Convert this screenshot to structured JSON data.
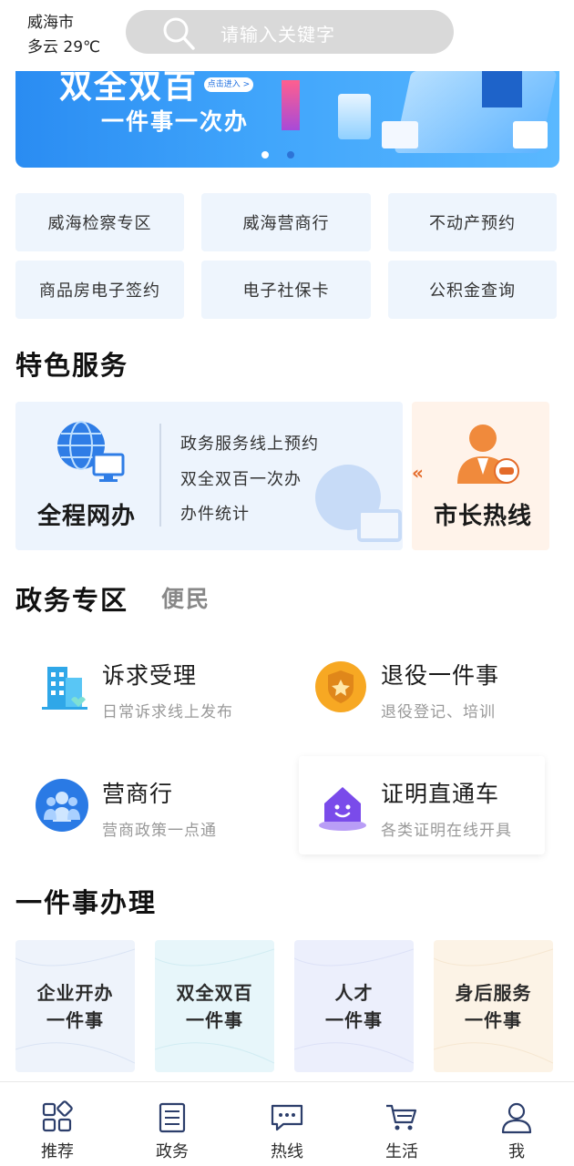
{
  "header": {
    "city": "威海市",
    "weather": "多云 29℃",
    "search_placeholder": "请输入关键字"
  },
  "banner": {
    "title": "双全双百",
    "subtitle": "一件事一次办",
    "enter_label": "点击进入 >",
    "slide_count": 2,
    "active_slide": 1
  },
  "quick_links": [
    {
      "label": "威海检察专区"
    },
    {
      "label": "威海营商行"
    },
    {
      "label": "不动产预约"
    },
    {
      "label": "商品房电子签约"
    },
    {
      "label": "电子社保卡"
    },
    {
      "label": "公积金查询"
    }
  ],
  "featured": {
    "heading": "特色服务",
    "main": {
      "title": "全程网办",
      "items": [
        "政务服务线上预约",
        "双全双百一次办",
        "办件统计"
      ]
    },
    "side": {
      "arrows": "«",
      "title": "市长热线"
    }
  },
  "gov_zone": {
    "heading": "政务专区",
    "tab_other": "便民",
    "services": [
      {
        "title": "诉求受理",
        "subtitle": "日常诉求线上发布"
      },
      {
        "title": "退役一件事",
        "subtitle": "退役登记、培训"
      },
      {
        "title": "营商行",
        "subtitle": "营商政策一点通"
      },
      {
        "title": "证明直通车",
        "subtitle": "各类证明在线开具"
      }
    ]
  },
  "one_thing": {
    "heading": "一件事办理",
    "items": [
      {
        "line1": "企业开办",
        "line2": "一件事",
        "bg": "#eef3fb"
      },
      {
        "line1": "双全双百",
        "line2": "一件事",
        "bg": "#e7f6fa"
      },
      {
        "line1": "人才",
        "line2": "一件事",
        "bg": "#eceffc"
      },
      {
        "line1": "身后服务",
        "line2": "一件事",
        "bg": "#fcf3e6"
      }
    ]
  },
  "tabbar": [
    {
      "label": "推荐",
      "icon": "grid-icon"
    },
    {
      "label": "政务",
      "icon": "list-icon"
    },
    {
      "label": "热线",
      "icon": "chat-icon"
    },
    {
      "label": "生活",
      "icon": "cart-icon"
    },
    {
      "label": "我",
      "icon": "user-icon"
    }
  ],
  "colors": {
    "primary": "#2a8cf2",
    "quick_bg": "#eef5fd",
    "accent_orange": "#e46b2a"
  }
}
